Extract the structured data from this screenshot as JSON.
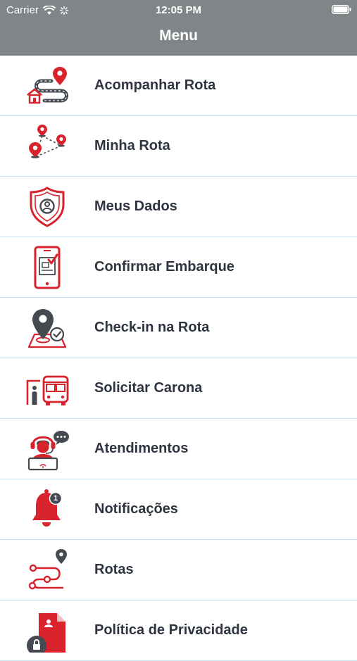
{
  "status_bar": {
    "carrier": "Carrier",
    "time": "12:05 PM"
  },
  "header": {
    "title": "Menu",
    "background": "#808588"
  },
  "colors": {
    "accent_red": "#d8222c",
    "icon_gray": "#454a50",
    "text": "#2e3440",
    "divider": "#bfe3f3"
  },
  "menu": {
    "items": [
      {
        "label": "Acompanhar Rota",
        "icon": "route-tracking-icon"
      },
      {
        "label": "Minha Rota",
        "icon": "map-pins-route-icon"
      },
      {
        "label": "Meus Dados",
        "icon": "shield-user-icon"
      },
      {
        "label": "Confirmar Embarque",
        "icon": "phone-checklist-icon"
      },
      {
        "label": "Check-in na Rota",
        "icon": "location-check-icon"
      },
      {
        "label": "Solicitar Carona",
        "icon": "bus-stop-icon"
      },
      {
        "label": "Atendimentos",
        "icon": "support-agent-icon"
      },
      {
        "label": "Notificações",
        "icon": "bell-icon",
        "badge": "1"
      },
      {
        "label": "Rotas",
        "icon": "route-path-icon"
      },
      {
        "label": "Política de Privacidade",
        "icon": "privacy-document-icon"
      }
    ]
  }
}
